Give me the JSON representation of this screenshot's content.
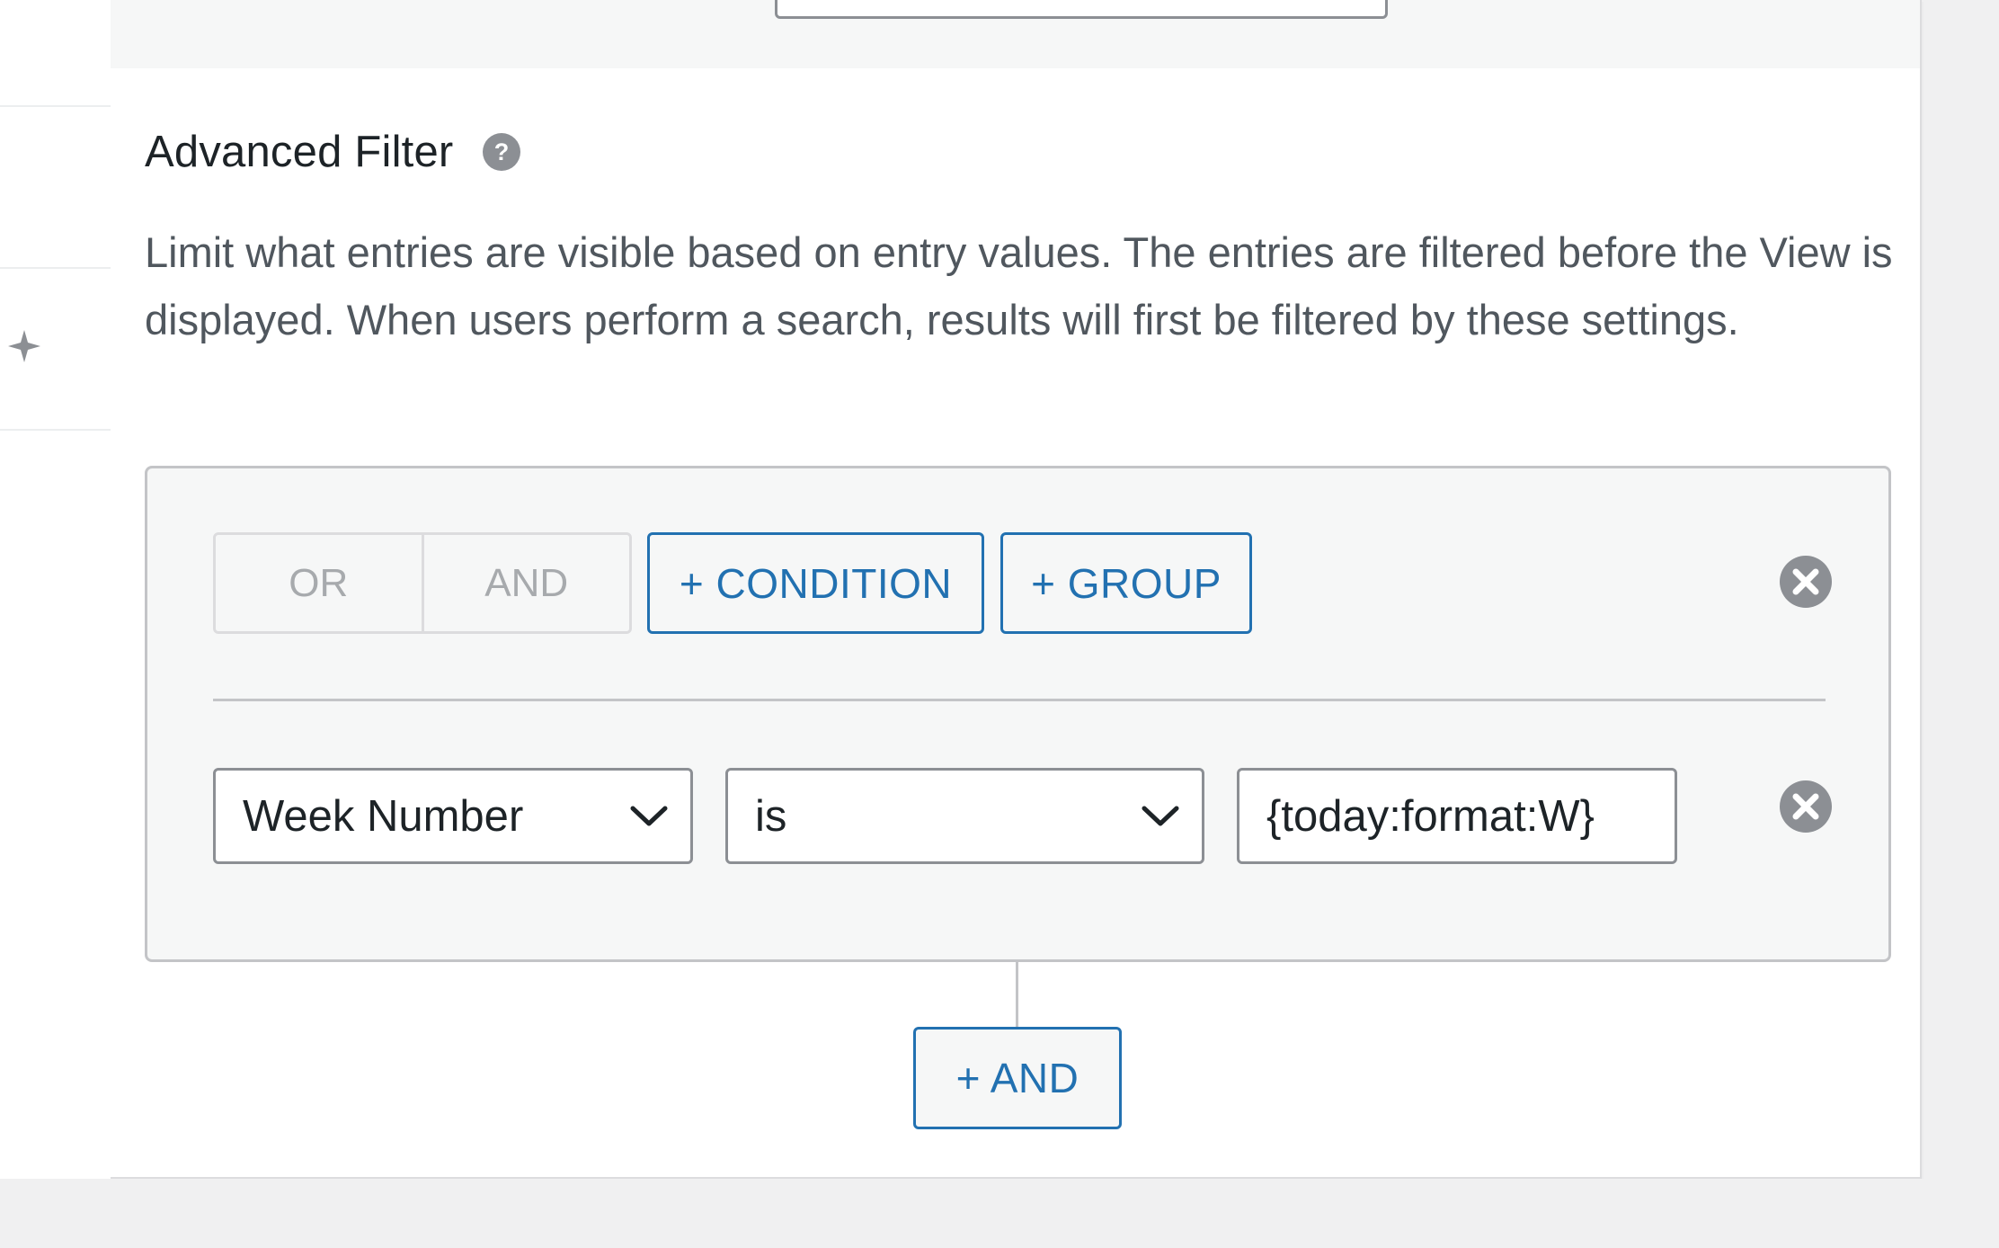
{
  "section": {
    "title": "Advanced Filter",
    "description": "Limit what entries are visible based on entry values. The entries are filtered before the View is displayed. When users perform a search, results will first be filtered by these settings."
  },
  "filter": {
    "mode_options": [
      "OR",
      "AND"
    ],
    "add_condition_label": "+ CONDITION",
    "add_group_label": "+ GROUP",
    "condition": {
      "field": "Week Number",
      "operator": "is",
      "value": "{today:format:W}"
    },
    "add_and_label": "+ AND"
  },
  "icons": {
    "help": "help-icon",
    "remove": "close-circle-icon",
    "dropdown": "chevron-down-icon",
    "sidebar": "sparkle-icon"
  },
  "colors": {
    "accent": "#2271b1",
    "border": "#c3c4c7",
    "panel_bg": "#f6f7f7",
    "muted_text": "#50575e",
    "icon_gray": "#8c8f94"
  }
}
